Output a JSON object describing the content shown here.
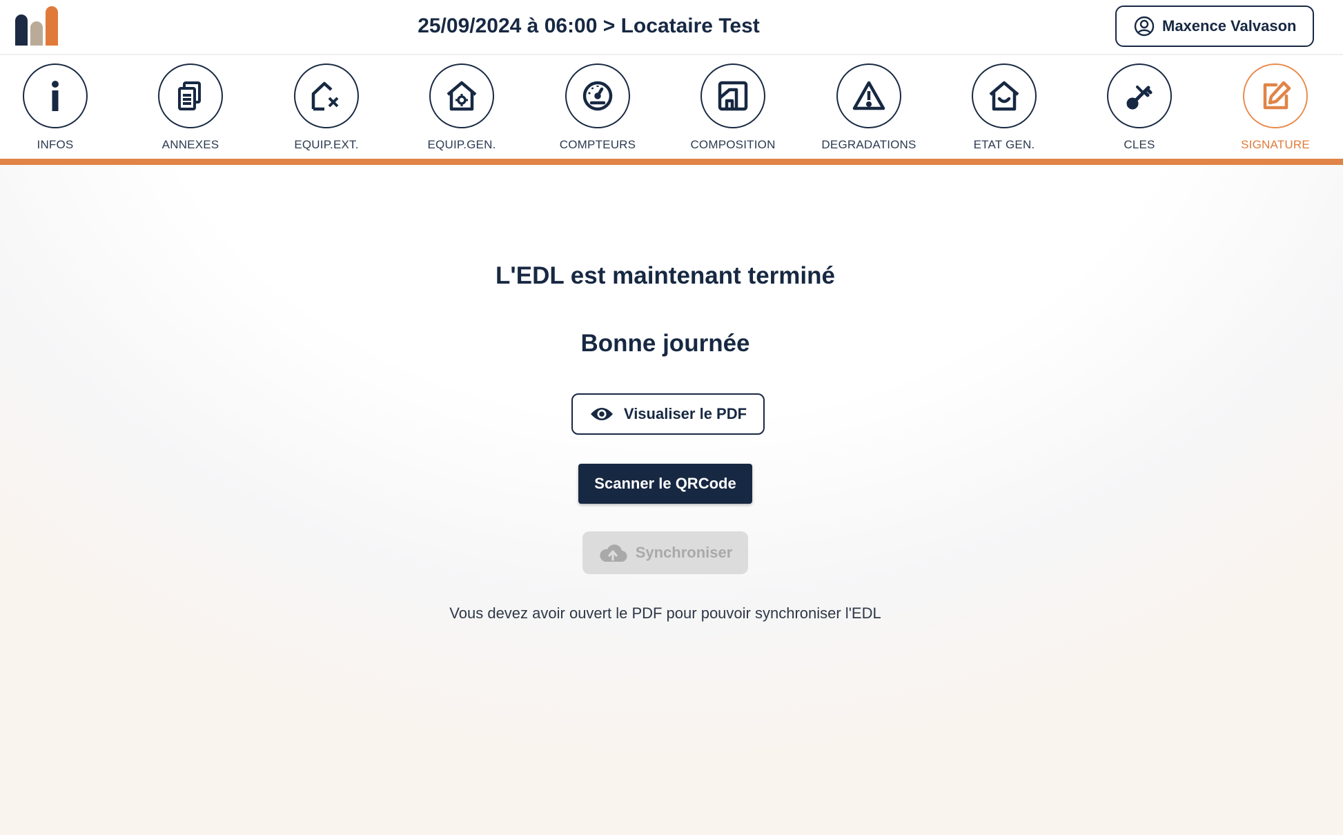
{
  "header": {
    "title": "25/09/2024 à 06:00 > Locataire Test",
    "user_name": "Maxence Valvason"
  },
  "logo": {
    "colors": [
      "#1c2a44",
      "#b9ab98",
      "#e07a3a"
    ]
  },
  "steps": [
    {
      "label": "INFOS",
      "icon": "info-icon",
      "active": false
    },
    {
      "label": "ANNEXES",
      "icon": "documents-icon",
      "active": false
    },
    {
      "label": "EQUIP.EXT.",
      "icon": "house-tools-icon",
      "active": false
    },
    {
      "label": "EQUIP.GEN.",
      "icon": "house-gear-icon",
      "active": false
    },
    {
      "label": "COMPTEURS",
      "icon": "gauge-icon",
      "active": false
    },
    {
      "label": "COMPOSITION",
      "icon": "floorplan-icon",
      "active": false
    },
    {
      "label": "DEGRADATIONS",
      "icon": "warning-icon",
      "active": false
    },
    {
      "label": "ETAT GEN.",
      "icon": "house-smile-icon",
      "active": false
    },
    {
      "label": "CLES",
      "icon": "key-icon",
      "active": false
    },
    {
      "label": "SIGNATURE",
      "icon": "edit-icon",
      "active": true
    }
  ],
  "main": {
    "title": "L'EDL est maintenant terminé",
    "subtitle": "Bonne journée",
    "view_pdf_label": "Visualiser le PDF",
    "scan_qr_label": "Scanner le QRCode",
    "sync_label": "Synchroniser",
    "hint": "Vous devez avoir ouvert le PDF pour pouvoir synchroniser l'EDL"
  },
  "colors": {
    "primary": "#172842",
    "accent": "#e08447",
    "disabled_bg": "#dcdcdc",
    "disabled_text": "#a9a9a9"
  }
}
